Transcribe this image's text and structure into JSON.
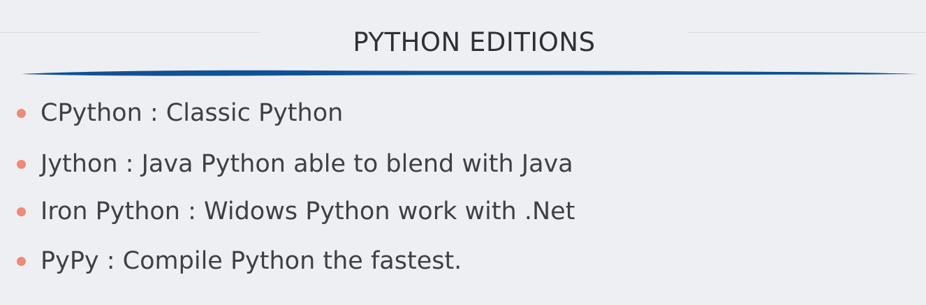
{
  "slide": {
    "title": "PYTHON EDITIONS",
    "bullets": [
      "CPython : Classic Python",
      "Jython : Java Python able to blend with Java",
      "Iron Python : Widows Python work with .Net",
      "PyPy : Compile Python the fastest."
    ]
  },
  "colors": {
    "background": "#eeeff3",
    "accent_stroke": "#0f5196",
    "bullet_dot": "#ef8a76",
    "text": "#3f3f45"
  }
}
